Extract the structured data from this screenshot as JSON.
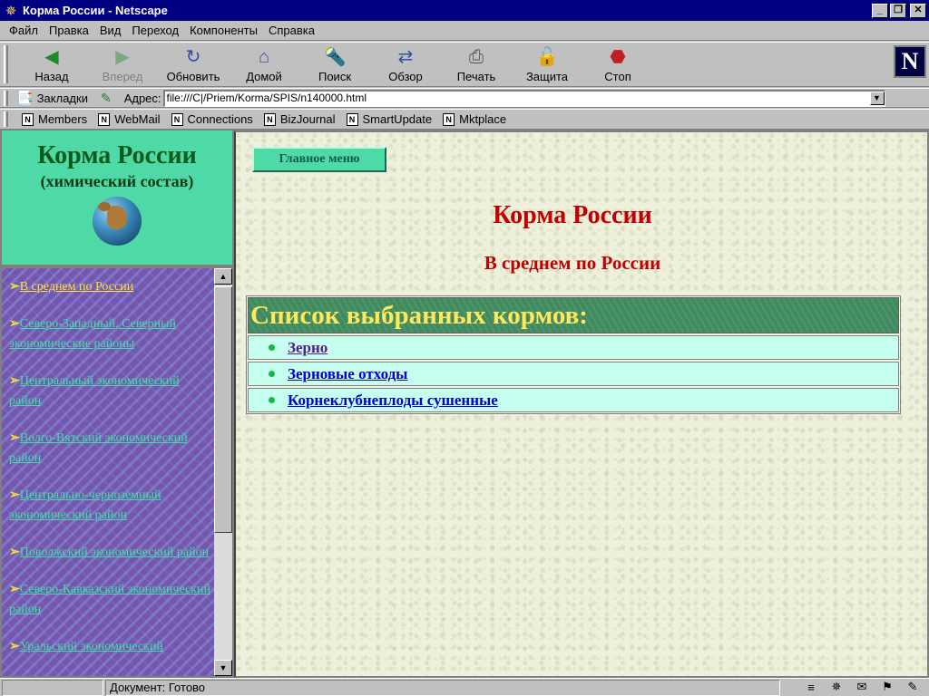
{
  "window": {
    "title": "Корма России - Netscape"
  },
  "menu": [
    "Файл",
    "Правка",
    "Вид",
    "Переход",
    "Компоненты",
    "Справка"
  ],
  "toolbar": {
    "back": "Назад",
    "forward": "Вперед",
    "reload": "Обновить",
    "home": "Домой",
    "search": "Поиск",
    "browse": "Обзор",
    "print": "Печать",
    "security": "Защита",
    "stop": "Стоп"
  },
  "location": {
    "bookmarks_label": "Закладки",
    "address_label": "Адрес:",
    "address_value": "file:///C|/Priem/Korma/SPIS/n140000.html"
  },
  "personal_toolbar": [
    "Members",
    "WebMail",
    "Connections",
    "BizJournal",
    "SmartUpdate",
    "Mktplace"
  ],
  "left_panel": {
    "title": "Корма России",
    "subtitle": "(химический состав)",
    "nav": [
      "В среднем по России",
      "Северо-Западный, Северный экономические районы",
      "Центральный экономический район",
      "Волго-Вятский экономический район",
      "Центрально-черноземный экономический район",
      "Поволжский экономический район",
      "Северо-Кавказский экономический район",
      "Уральский экономический"
    ]
  },
  "main": {
    "main_menu_button": "Главное меню",
    "title": "Корма России",
    "subtitle": "В среднем по России",
    "list_header": "Список выбранных кормов:",
    "items": [
      "Зерно",
      "Зерновые отходы",
      "Корнеклубнеплоды сушенные"
    ]
  },
  "status": {
    "text": "Документ: Готово"
  },
  "colors": {
    "title_bar": "#000080",
    "left_header_bg": "#4fd9a6",
    "heading_red": "#c00000",
    "list_header_bg": "#3f8a5e",
    "list_header_text": "#ffe85c",
    "list_row_bg": "#c6fff0"
  }
}
